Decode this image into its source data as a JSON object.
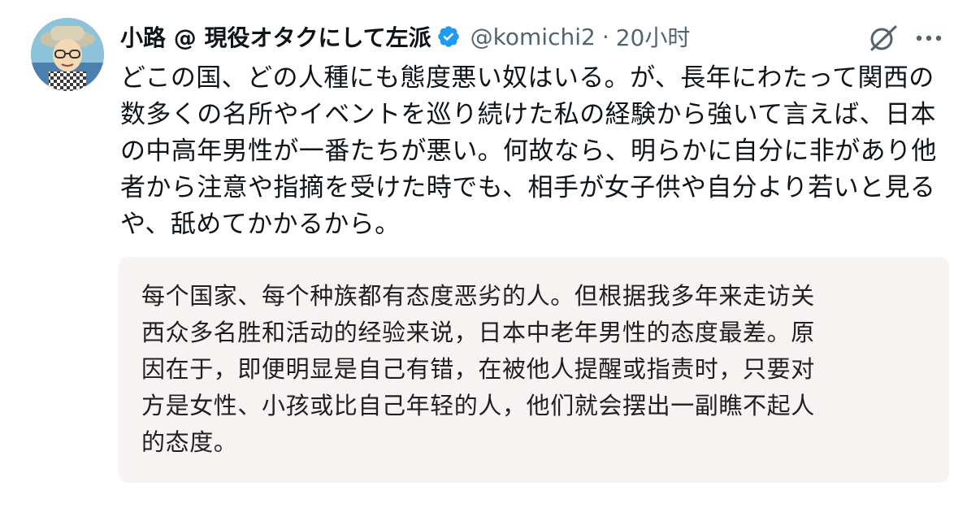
{
  "tweet": {
    "author": {
      "display_name": "小路 @ 現役オタクにして左派",
      "handle": "@komichi2",
      "verified_icon": "verified-badge-icon",
      "avatar": "avatar"
    },
    "separator": "·",
    "time": "20小时",
    "actions": {
      "grok_icon": "grok-icon",
      "more_icon": "more-dots-icon"
    },
    "text": "どこの国、どの人種にも態度悪い奴はいる。が、長年にわたって関西の\n数多くの名所やイベントを巡り続けた私の経験から強いて言えば、日本\nの中高年男性が一番たちが悪い。何故なら、明らかに自分に非があり他\n者から注意や指摘を受けた時でも、相手が女子供や自分より若いと見る\nや、舐めてかかるから。",
    "translation": "每个国家、每个种族都有态度恶劣的人。但根据我多年来走访关\n西众多名胜和活动的经验来说，日本中老年男性的态度最差。原\n因在于，即便明显是自己有错，在被他人提醒或指责时，只要对\n方是女性、小孩或比自己年轻的人，他们就会摆出一副瞧不起人\n的态度。"
  },
  "colors": {
    "text": "#0f1419",
    "secondary": "#536471",
    "verified": "#1d9bf0",
    "translation_bg": "#f7f3f2"
  }
}
